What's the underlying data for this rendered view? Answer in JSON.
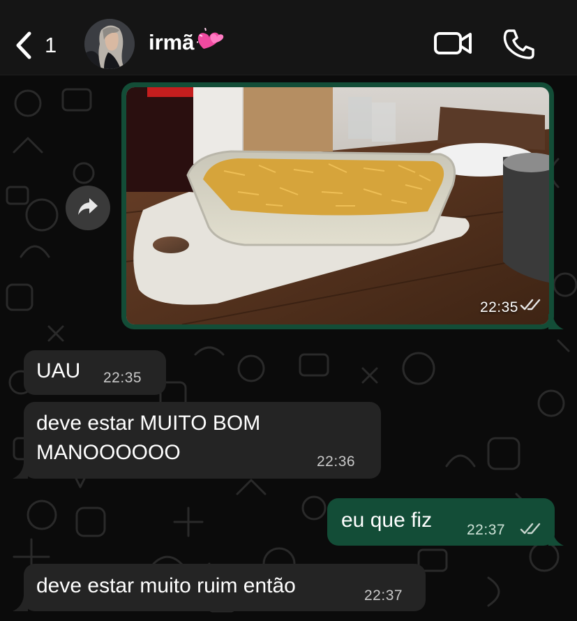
{
  "header": {
    "unread_count": "1",
    "contact_name": "irmã",
    "contact_emoji": "💞"
  },
  "colors": {
    "header_bg": "#151515",
    "chat_bg": "#0b0b0b",
    "incoming_bubble": "#242424",
    "outgoing_bubble": "#134d37",
    "read_ticks": "#c9d6cf"
  },
  "icons": {
    "back": "chevron-left-icon",
    "video_call": "video-camera-icon",
    "voice_call": "phone-icon",
    "forward": "forward-arrow-icon",
    "read_receipt": "double-check-icon"
  },
  "messages": [
    {
      "id": "m1",
      "direction": "out",
      "type": "photo",
      "photo_description": "glass baking dish with shoestring potato topping on a cutting board",
      "time": "22:35",
      "status": "read"
    },
    {
      "id": "m2",
      "direction": "in",
      "type": "text",
      "text": "UAU",
      "time": "22:35"
    },
    {
      "id": "m3",
      "direction": "in",
      "type": "text",
      "text_line1": "deve estar MUITO BOM",
      "text_line2": "MANOOOOOO",
      "time": "22:36"
    },
    {
      "id": "m4",
      "direction": "out",
      "type": "text",
      "text": "eu que fiz",
      "time": "22:37",
      "status": "read"
    },
    {
      "id": "m5",
      "direction": "in",
      "type": "text",
      "text": "deve estar muito ruim então",
      "time": "22:37"
    }
  ]
}
